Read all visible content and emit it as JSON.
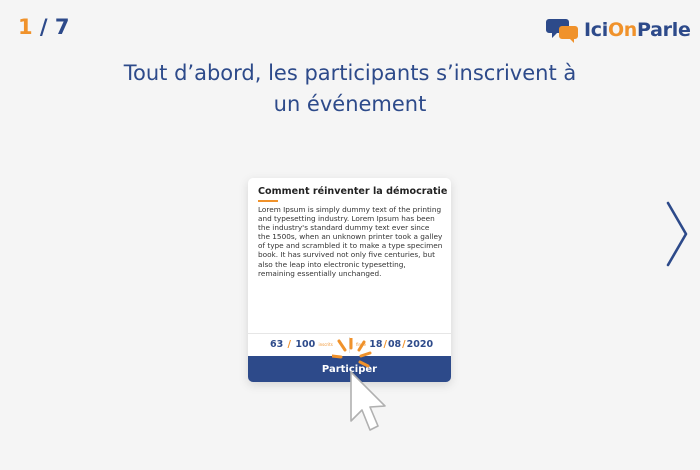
{
  "slide": {
    "current": "1",
    "separator": " / ",
    "total": "7"
  },
  "brand": {
    "name_part1": "Ici",
    "name_part2": "On",
    "name_part3": "Parle"
  },
  "headline": {
    "line1": "Tout d’abord, les participants s’inscrivent à",
    "line2": "un événement"
  },
  "card": {
    "title": "Comment réinventer la démocratie ?",
    "body": "Lorem Ipsum is simply dummy text of the printing and typesetting industry. Lorem Ipsum has been the industry's standard dummy text ever since the 1500s, when an unknown printer took a galley of type and scrambled it to make a type specimen book. It has survived not only five centuries, but also the leap into electronic typesetting, remaining essentially unchanged.",
    "participants_count": "63",
    "participants_sep": "/",
    "participants_max": "100",
    "participants_unit": "inscrits",
    "date_prefix": "fin le",
    "date_day": "18",
    "date_sep1": "/",
    "date_month": "08",
    "date_sep2": "/",
    "date_year": "2020",
    "participate_label": "Participer"
  },
  "icons": {
    "next": "chevron-right-icon",
    "cursor": "mouse-pointer-icon",
    "brand": "chat-bubbles-icon"
  },
  "colors": {
    "primary": "#2d4a8a",
    "accent": "#f0922b",
    "background": "#f5f5f5"
  }
}
